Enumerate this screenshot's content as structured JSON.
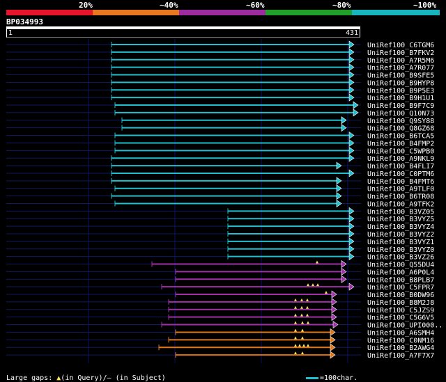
{
  "legend": {
    "percent_labels": [
      "20%",
      "~40%",
      "~60%",
      "~80%",
      "~100%"
    ],
    "bands": [
      {
        "color": "#e8142c"
      },
      {
        "color": "#e87820"
      },
      {
        "color": "#9c2ca0"
      },
      {
        "color": "#20a028"
      },
      {
        "color": "#18b4c0"
      }
    ]
  },
  "query": {
    "id": "BP034993",
    "start": "1",
    "end": "431"
  },
  "colors": {
    "cyan": "#20c0d0",
    "purple": "#a030a8",
    "orange": "#e07818",
    "track": "#101a60",
    "gap": "#ffe060"
  },
  "hits": [
    {
      "label": "UniRef100_C6TGM6",
      "start": 160,
      "end": 508,
      "color": "cyan"
    },
    {
      "label": "UniRef100_B7FKV2",
      "start": 160,
      "end": 508,
      "color": "cyan"
    },
    {
      "label": "UniRef100_A7R5M6",
      "start": 160,
      "end": 508,
      "color": "cyan"
    },
    {
      "label": "UniRef100_A7R077",
      "start": 160,
      "end": 508,
      "color": "cyan"
    },
    {
      "label": "UniRef100_B9SFE5",
      "start": 160,
      "end": 508,
      "color": "cyan"
    },
    {
      "label": "UniRef100_B9HYP8",
      "start": 160,
      "end": 508,
      "color": "cyan"
    },
    {
      "label": "UniRef100_B9P5E3",
      "start": 160,
      "end": 508,
      "color": "cyan"
    },
    {
      "label": "UniRef100_B9H1U1",
      "start": 160,
      "end": 508,
      "color": "cyan"
    },
    {
      "label": "UniRef100_B9F7C9",
      "start": 165,
      "end": 514,
      "color": "cyan"
    },
    {
      "label": "UniRef100_Q10N73",
      "start": 165,
      "end": 514,
      "color": "cyan"
    },
    {
      "label": "UniRef100_Q9SY88",
      "start": 175,
      "end": 497,
      "color": "cyan"
    },
    {
      "label": "UniRef100_Q8GZ68",
      "start": 175,
      "end": 497,
      "color": "cyan"
    },
    {
      "label": "UniRef100_B6TCA5",
      "start": 165,
      "end": 508,
      "color": "cyan"
    },
    {
      "label": "UniRef100_B4FMP2",
      "start": 165,
      "end": 508,
      "color": "cyan"
    },
    {
      "label": "UniRef100_C5WPB0",
      "start": 165,
      "end": 508,
      "color": "cyan"
    },
    {
      "label": "UniRef100_A9NKL9",
      "start": 160,
      "end": 508,
      "color": "cyan"
    },
    {
      "label": "UniRef100_B4FLI7",
      "start": 160,
      "end": 490,
      "color": "cyan"
    },
    {
      "label": "UniRef100_C0PTM6",
      "start": 160,
      "end": 508,
      "color": "cyan"
    },
    {
      "label": "UniRef100_B4FMT6",
      "start": 160,
      "end": 490,
      "color": "cyan"
    },
    {
      "label": "UniRef100_A9TLF0",
      "start": 165,
      "end": 490,
      "color": "cyan"
    },
    {
      "label": "UniRef100_B6TR08",
      "start": 160,
      "end": 490,
      "color": "cyan"
    },
    {
      "label": "UniRef100_A9TFK2",
      "start": 165,
      "end": 490,
      "color": "cyan"
    },
    {
      "label": "UniRef100_B3VZ05",
      "start": 327,
      "end": 508,
      "color": "cyan"
    },
    {
      "label": "UniRef100_B3VYZ5",
      "start": 327,
      "end": 508,
      "color": "cyan"
    },
    {
      "label": "UniRef100_B3VYZ4",
      "start": 327,
      "end": 508,
      "color": "cyan"
    },
    {
      "label": "UniRef100_B3VYZ2",
      "start": 327,
      "end": 508,
      "color": "cyan"
    },
    {
      "label": "UniRef100_B3VYZ1",
      "start": 327,
      "end": 508,
      "color": "cyan"
    },
    {
      "label": "UniRef100_B3VYZ0",
      "start": 327,
      "end": 508,
      "color": "cyan"
    },
    {
      "label": "UniRef100_B3VZ26",
      "start": 327,
      "end": 508,
      "color": "cyan"
    },
    {
      "label": "UniRef100_Q55DU4",
      "start": 218,
      "end": 497,
      "color": "purple",
      "gaps": [
        455
      ]
    },
    {
      "label": "UniRef100_A6P0L4",
      "start": 252,
      "end": 497,
      "color": "purple"
    },
    {
      "label": "UniRef100_B8PLB7",
      "start": 252,
      "end": 497,
      "color": "purple"
    },
    {
      "label": "UniRef100_C5FPR7",
      "start": 232,
      "end": 508,
      "color": "purple",
      "gaps": [
        442,
        449,
        456
      ]
    },
    {
      "label": "UniRef100_B0DW96",
      "start": 252,
      "end": 483,
      "color": "purple",
      "gaps": [
        468
      ]
    },
    {
      "label": "UniRef100_B8M2J8",
      "start": 242,
      "end": 483,
      "color": "purple",
      "gaps": [
        424,
        433,
        441
      ]
    },
    {
      "label": "UniRef100_C5JZS9",
      "start": 242,
      "end": 483,
      "color": "purple",
      "gaps": [
        424,
        433,
        441
      ]
    },
    {
      "label": "UniRef100_C5G6V5",
      "start": 242,
      "end": 483,
      "color": "purple",
      "gaps": [
        424,
        433,
        441
      ]
    },
    {
      "label": "UniRef100_UPI000..",
      "start": 232,
      "end": 485,
      "color": "purple",
      "gaps": [
        424,
        434,
        442
      ]
    },
    {
      "label": "UniRef100_A6SMH4",
      "start": 252,
      "end": 481,
      "color": "orange",
      "gaps": [
        424,
        434
      ]
    },
    {
      "label": "UniRef100_C0NM16",
      "start": 242,
      "end": 481,
      "color": "orange",
      "gaps": [
        424,
        434
      ]
    },
    {
      "label": "UniRef100_B2AWG4",
      "start": 228,
      "end": 481,
      "color": "orange",
      "gaps": [
        424,
        430,
        436,
        442
      ]
    },
    {
      "label": "UniRef100_A7F7X7",
      "start": 252,
      "end": 481,
      "color": "orange",
      "gaps": [
        424,
        434
      ]
    }
  ],
  "footer": {
    "large_gaps_label": "Large gaps:",
    "query_symbol": "▲",
    "query_text": "(in Query)/",
    "subject_symbol": "–",
    "subject_text": " (in Subject)",
    "scale_label": "=100char."
  }
}
